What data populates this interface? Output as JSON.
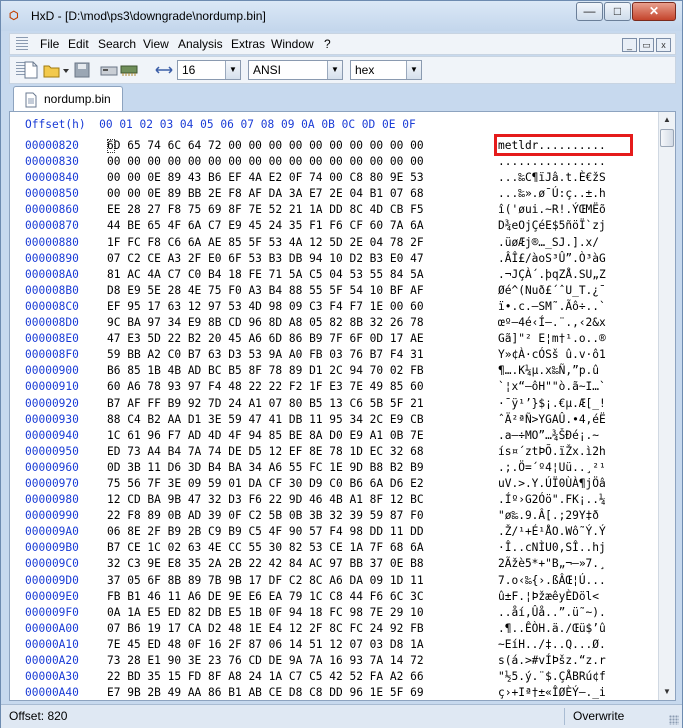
{
  "window": {
    "title": "HxD - [D:\\mod\\ps3\\downgrade\\nordump.bin]"
  },
  "caption_buttons": {
    "minimize": "—",
    "maximize": "□",
    "close": "✕"
  },
  "menu": [
    "File",
    "Edit",
    "Search",
    "View",
    "Analysis",
    "Extras",
    "Window",
    "?"
  ],
  "mdi_buttons": {
    "minimize": "_",
    "restore": "▭",
    "close": "x"
  },
  "toolbar": {
    "bytes_per_row": "16",
    "charset": "ANSI",
    "offset_base": "hex"
  },
  "tab": {
    "label": "nordump.bin"
  },
  "editor": {
    "offset_header": "Offset(h)",
    "column_header": "00 01 02 03 04 05 06 07 08 09 0A 0B 0C 0D 0E 0F",
    "rows": [
      {
        "offset": "00000820",
        "hex": "6D 65 74 6C 64 72 00 00 00 00 00 00 00 00 00 00",
        "ascii": "metldr.........."
      },
      {
        "offset": "00000830",
        "hex": "00 00 00 00 00 00 00 00 00 00 00 00 00 00 00 00",
        "ascii": "................"
      },
      {
        "offset": "00000840",
        "hex": "00 00 0E 89 43 B6 EF 4A E2 0F 74 00 C8 80 9E 53",
        "ascii": "...‰C¶ïJâ.t.È€žS"
      },
      {
        "offset": "00000850",
        "hex": "00 00 0E 89 BB 2E F8 AF DA 3A E7 2E 04 B1 07 68",
        "ascii": "...‰».ø¯Ú:ç..±.h"
      },
      {
        "offset": "00000860",
        "hex": "EE 28 27 F8 75 69 8F 7E 52 21 1A DD 8C 4D CB F5",
        "ascii": "î('øui.~R!.ÝŒMËõ"
      },
      {
        "offset": "00000870",
        "hex": "44 BE 65 4F 6A C7 E9 45 24 35 F1 F6 CF 60 7A 6A",
        "ascii": "D¾eOjÇéE$5ñöÏ`zj"
      },
      {
        "offset": "00000880",
        "hex": "1F FC F8 C6 6A AE 85 5F 53 4A 12 5D 2E 04 78 2F",
        "ascii": ".üøÆj®…_SJ.].x/"
      },
      {
        "offset": "00000890",
        "hex": "07 C2 CE A3 2F E0 6F 53 B3 DB 94 10 D2 B3 E0 47",
        "ascii": ".ÂÎ£/àoS³Û”.Ò³àG"
      },
      {
        "offset": "000008A0",
        "hex": "81 AC 4A C7 C0 B4 18 FE 71 5A C5 04 53 55 84 5A",
        "ascii": ".¬JÇÀ´.þqZÅ.SU„Z"
      },
      {
        "offset": "000008B0",
        "hex": "D8 E9 5E 28 4E 75 F0 A3 B4 88 55 5F 54 10 BF AF",
        "ascii": "Øé^(Nuð£´ˆU_T.¿¯"
      },
      {
        "offset": "000008C0",
        "hex": "EF 95 17 63 12 97 53 4D 98 09 C3 F4 F7 1E 00 60",
        "ascii": "ï•.c.—SM˜.Ãô÷..`"
      },
      {
        "offset": "000008D0",
        "hex": "9C BA 97 34 E9 8B CD 96 8D A8 05 82 8B 32 26 78",
        "ascii": "œº—4é‹Í–.¨.‚‹2&x"
      },
      {
        "offset": "000008E0",
        "hex": "47 E3 5D 22 B2 20 45 A6 6D 86 B9 7F 6F 0D 17 AE",
        "ascii": "Gã]\"² E¦m†¹.o..®"
      },
      {
        "offset": "000008F0",
        "hex": "59 BB A2 C0 B7 63 D3 53 9A A0 FB 03 76 B7 F4 31",
        "ascii": "Y»¢À·cÓSš û.v·ô1"
      },
      {
        "offset": "00000900",
        "hex": "B6 85 1B 4B AD BC B5 8F 78 89 D1 2C 94 70 02 FB",
        "ascii": "¶….K­¼µ.x‰Ñ,”p.û"
      },
      {
        "offset": "00000910",
        "hex": "60 A6 78 93 97 F4 48 22 22 F2 1F E3 7E 49 85 60",
        "ascii": "`¦x“—ôH\"\"ò.ã~I…`"
      },
      {
        "offset": "00000920",
        "hex": "B7 AF FF B9 92 7D 24 A1 07 80 B5 13 C6 5B 5F 21",
        "ascii": "·¯ÿ¹’}$¡.€µ.Æ[_!"
      },
      {
        "offset": "00000930",
        "hex": "88 C4 B2 AA D1 3E 59 47 41 DB 11 95 34 2C E9 CB",
        "ascii": "ˆÄ²ªÑ>YGAÛ.•4,éË"
      },
      {
        "offset": "00000940",
        "hex": "1C 61 96 F7 AD 4D 4F 94 85 BE 8A D0 E9 A1 0B 7E",
        "ascii": ".a–÷­MO”…¾ŠÐé¡.~"
      },
      {
        "offset": "00000950",
        "hex": "ED 73 A4 B4 7A 74 DE D5 12 EF 8E 78 1D EC 32 68",
        "ascii": "ís¤´ztÞÕ.ïŽx.ì2h"
      },
      {
        "offset": "00000960",
        "hex": "0D 3B 11 D6 3D B4 BA 34 A6 55 FC 1E 9D B8 B2 B9",
        "ascii": ".;.Ö=´º4¦Uü..¸²¹"
      },
      {
        "offset": "00000970",
        "hex": "75 56 7F 3E 09 59 01 DA CF 30 D9 C0 B6 6A D6 E2",
        "ascii": "uV.>.Y.ÚÏ0ÙÀ¶jÖâ"
      },
      {
        "offset": "00000980",
        "hex": "12 CD BA 9B 47 32 D3 F6 22 9D 46 4B A1 8F 12 BC",
        "ascii": ".Íº›G2Óö\".FK¡..¼"
      },
      {
        "offset": "00000990",
        "hex": "22 F8 89 0B AD 39 0F C2 5B 0B 3B 32 39 59 87 F0",
        "ascii": "\"ø‰.­9.Â[.;29Y‡ð"
      },
      {
        "offset": "000009A0",
        "hex": "06 8E 2F B9 2B C9 B9 C5 4F 90 57 F4 98 DD 11 DD",
        "ascii": ".Ž/¹+É¹ÅO.Wô˜Ý.Ý"
      },
      {
        "offset": "000009B0",
        "hex": "B7 CE 1C 02 63 4E CC 55 30 82 53 CE 1A 7F 68 6A",
        "ascii": "·Î..cNÌU0‚SÎ..hj"
      },
      {
        "offset": "000009C0",
        "hex": "32 C3 9E E8 35 2A 2B 22 42 84 AC 97 BB 37 0E B8",
        "ascii": "2Ãžè5*+\"B„¬—»7.¸"
      },
      {
        "offset": "000009D0",
        "hex": "37 05 6F 8B 89 7B 9B 17 DF C2 8C A6 DA 09 1D 11",
        "ascii": "7.o‹‰{›.ßÂŒ¦Ú..."
      },
      {
        "offset": "000009E0",
        "hex": "FB B1 46 11 A6 DE 9E E6 EA 79 1C C8 44 F6 6C 3C",
        "ascii": "û±F.¦ÞžæêyÈDöl<"
      },
      {
        "offset": "000009F0",
        "hex": "0A 1A E5 ED 82 DB E5 1B 0F 94 18 FC 98 7E 29 10",
        "ascii": "..åí‚Ûå..”.ü˜~)."
      },
      {
        "offset": "00000A00",
        "hex": "07 B6 19 17 CA D2 48 1E E4 12 2F 8C FC 24 92 FB",
        "ascii": ".¶..ÊÒH.ä./Œü$’û"
      },
      {
        "offset": "00000A10",
        "hex": "7E 45 ED 48 0F 16 2F 87 06 14 51 12 07 03 D8 1A",
        "ascii": "~EíH../‡..Q...Ø."
      },
      {
        "offset": "00000A20",
        "hex": "73 28 E1 90 3E 23 76 CD DE 9A 7A 16 93 7A 14 72",
        "ascii": "s(á.>#vÍÞšz.“z.r"
      },
      {
        "offset": "00000A30",
        "hex": "22 BD 35 15 FD 8F A8 24 1A C7 C5 42 52 FA A2 66",
        "ascii": "\"½5.ý.¨$.ÇÅBRú¢f"
      },
      {
        "offset": "00000A40",
        "hex": "E7 9B 2B 49 AA 86 B1 AB CE D8 C8 DD 96 1E 5F 69",
        "ascii": "ç›+Iª†±«ÎØÈÝ–._i"
      }
    ]
  },
  "status": {
    "offset": "Offset: 820",
    "mode": "Overwrite"
  },
  "colors": {
    "offset_text": "#1a3cd6",
    "highlight": "#e51b1b"
  }
}
